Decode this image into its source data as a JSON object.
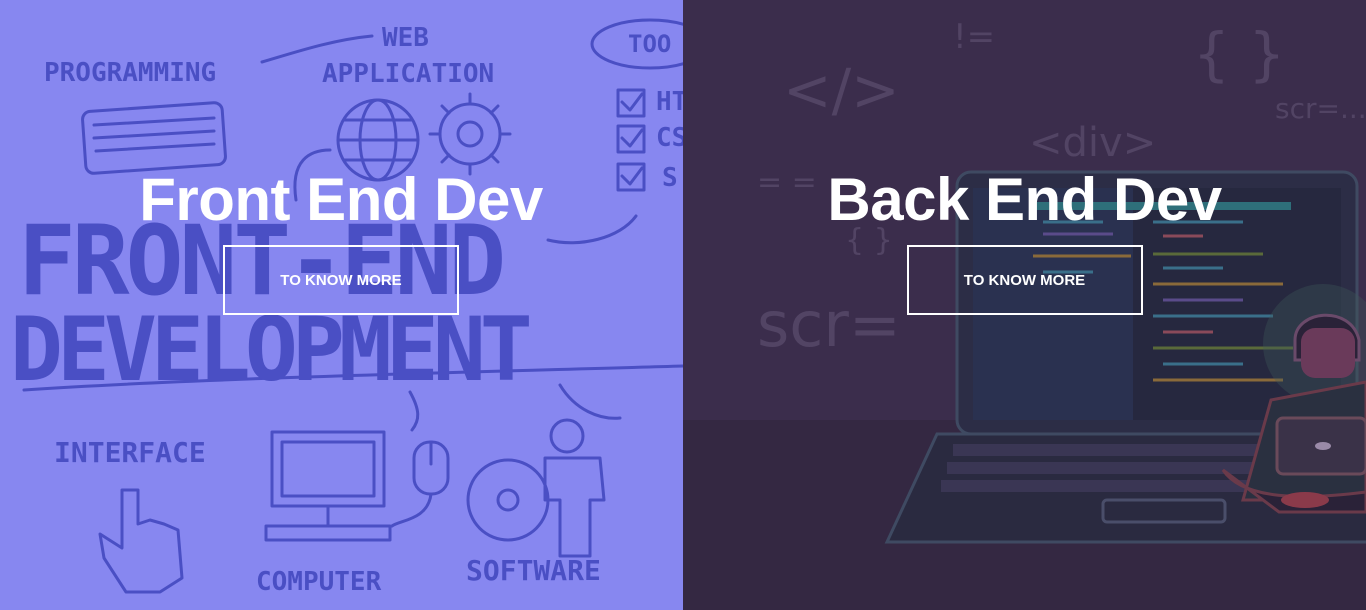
{
  "panels": [
    {
      "title": "Front End Dev",
      "button_label": "TO KNOW MORE",
      "background": "#8787f0"
    },
    {
      "title": "Back End Dev",
      "button_label": "TO KNOW MORE",
      "background": "#3b2d4c"
    }
  ],
  "front_art": {
    "words": [
      "PROGRAMMING",
      "WEB",
      "APPLICATION",
      "TOO",
      "FRONT-END",
      "DEVELOPMENT",
      "INTERFACE",
      "COMPUTER",
      "SOFTWARE",
      "HT",
      "CS",
      "S"
    ],
    "ink_color": "#4a4fc4"
  },
  "back_art": {
    "code_glyphs": [
      "</>",
      "!=",
      "{ }",
      "scr=...",
      "<div>",
      "= =",
      "{ }",
      "scr="
    ],
    "glyph_color": "#5a4b6e"
  }
}
